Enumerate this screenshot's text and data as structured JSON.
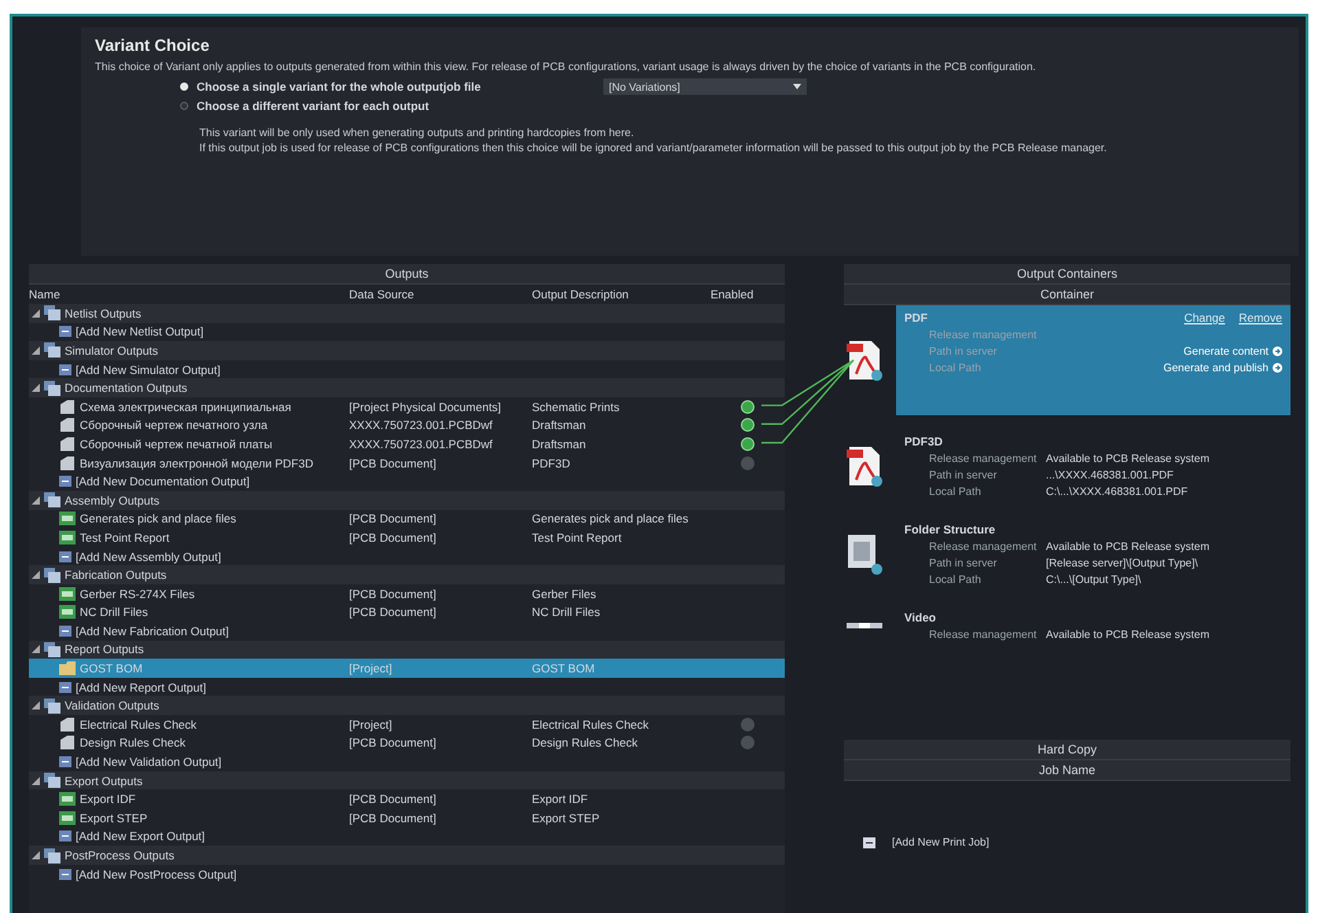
{
  "variant_choice": {
    "title": "Variant Choice",
    "note": "This choice of Variant only applies to outputs generated from within this view. For release of PCB configurations, variant usage is always driven by the choice of variants in the PCB configuration.",
    "options": [
      {
        "label": "Choose a single variant for the whole outputjob file",
        "selected": true,
        "dropdown": "[No Variations]"
      },
      {
        "label": "Choose a different variant for each output",
        "selected": false
      }
    ],
    "details": [
      "This variant will be only used when generating outputs and printing hardcopies from here.",
      "If this output job is used for release of PCB configurations then this choice will be ignored and variant/parameter information will be passed to this output job by the PCB Release manager."
    ]
  },
  "outputs": {
    "title": "Outputs",
    "columns": [
      "Name",
      "Data Source",
      "Output Description",
      "Enabled"
    ],
    "rows": [
      {
        "kind": "group",
        "name": "Netlist Outputs",
        "selected": false
      },
      {
        "kind": "add",
        "name": "[Add New Netlist Output]",
        "selected": false
      },
      {
        "kind": "group",
        "name": "Simulator Outputs",
        "selected": false
      },
      {
        "kind": "add",
        "name": "[Add New Simulator Output]",
        "selected": false
      },
      {
        "kind": "group",
        "name": "Documentation Outputs",
        "selected": false
      },
      {
        "kind": "document",
        "name": "Схема электрическая принципиальная",
        "source": "[Project Physical Documents]",
        "description": "Schematic Prints",
        "enabled": true,
        "selected": false
      },
      {
        "kind": "document",
        "name": "Сборочный чертеж печатного узла",
        "source": "XXXX.750723.001.PCBDwf",
        "description": "Draftsman",
        "enabled": true,
        "selected": false
      },
      {
        "kind": "document",
        "name": "Сборочный чертеж печатной платы",
        "source": "XXXX.750723.001.PCBDwf",
        "description": "Draftsman",
        "enabled": true,
        "selected": false
      },
      {
        "kind": "document",
        "name": "Визуализация электронной модели PDF3D",
        "source": "[PCB Document]",
        "description": "PDF3D",
        "enabled": false,
        "selected": false
      },
      {
        "kind": "add",
        "name": "[Add New Documentation Output]",
        "selected": false
      },
      {
        "kind": "group",
        "name": "Assembly Outputs",
        "selected": false
      },
      {
        "kind": "generator",
        "name": "Generates pick and place files",
        "source": "[PCB Document]",
        "description": "Generates pick and place files",
        "selected": false
      },
      {
        "kind": "generator",
        "name": "Test Point Report",
        "source": "[PCB Document]",
        "description": "Test Point Report",
        "selected": false
      },
      {
        "kind": "add",
        "name": "[Add New Assembly Output]",
        "selected": false
      },
      {
        "kind": "group",
        "name": "Fabrication Outputs",
        "selected": false
      },
      {
        "kind": "generator",
        "name": "Gerber RS-274X Files",
        "source": "[PCB Document]",
        "description": "Gerber Files",
        "selected": false
      },
      {
        "kind": "generator",
        "name": "NC Drill Files",
        "source": "[PCB Document]",
        "description": "NC Drill Files",
        "selected": false
      },
      {
        "kind": "add",
        "name": "[Add New Fabrication Output]",
        "selected": false
      },
      {
        "kind": "group",
        "name": "Report Outputs",
        "selected": false
      },
      {
        "kind": "report",
        "name": "GOST BOM",
        "source": "[Project]",
        "description": "GOST BOM",
        "selected": true
      },
      {
        "kind": "add",
        "name": "[Add New Report Output]",
        "selected": false
      },
      {
        "kind": "group",
        "name": "Validation Outputs",
        "selected": false
      },
      {
        "kind": "document",
        "name": "Electrical Rules Check",
        "source": "[Project]",
        "description": "Electrical Rules Check",
        "enabled": false,
        "selected": false
      },
      {
        "kind": "document",
        "name": "Design Rules Check",
        "source": "[PCB Document]",
        "description": "Design Rules Check",
        "enabled": false,
        "selected": false
      },
      {
        "kind": "add",
        "name": "[Add New Validation Output]",
        "selected": false
      },
      {
        "kind": "group",
        "name": "Export Outputs",
        "selected": false
      },
      {
        "kind": "generator",
        "name": "Export IDF",
        "source": "[PCB Document]",
        "description": "Export IDF",
        "selected": false
      },
      {
        "kind": "generator",
        "name": "Export STEP",
        "source": "[PCB Document]",
        "description": "Export STEP",
        "selected": false
      },
      {
        "kind": "add",
        "name": "[Add New Export Output]",
        "selected": false
      },
      {
        "kind": "group",
        "name": "PostProcess Outputs",
        "selected": false
      },
      {
        "kind": "add",
        "name": "[Add New PostProcess Output]",
        "selected": false
      }
    ]
  },
  "containers": {
    "title": "Output Containers",
    "column": "Container",
    "items": [
      {
        "kind": "pdf",
        "name": "PDF",
        "selected": true,
        "links": [
          "Change",
          "Remove"
        ],
        "fields": [
          {
            "label": "Release management"
          },
          {
            "label": "Path in server"
          },
          {
            "label": "Local Path"
          }
        ],
        "actions": [
          "Generate content",
          "Generate and publish"
        ]
      },
      {
        "kind": "pdf",
        "name": "PDF3D",
        "selected": false,
        "fields": [
          {
            "label": "Release management",
            "value": "Available to PCB Release system"
          },
          {
            "label": "Path in server",
            "value": "...\\XXXX.468381.001.PDF"
          },
          {
            "label": "Local Path",
            "value": "C:\\...\\XXXX.468381.001.PDF"
          }
        ]
      },
      {
        "kind": "folder",
        "name": "Folder Structure",
        "selected": false,
        "fields": [
          {
            "label": "Release management",
            "value": "Available to PCB Release system"
          },
          {
            "label": "Path in server",
            "value": "[Release server]\\[Output Type]\\"
          },
          {
            "label": "Local Path",
            "value": "C:\\...\\[Output Type]\\"
          }
        ]
      },
      {
        "kind": "video",
        "name": "Video",
        "selected": false,
        "fields": [
          {
            "label": "Release management",
            "value": "Available to PCB Release system"
          }
        ]
      }
    ]
  },
  "hard_copy": {
    "title": "Hard Copy",
    "column": "Job Name",
    "add": "[Add New Print Job]"
  }
}
